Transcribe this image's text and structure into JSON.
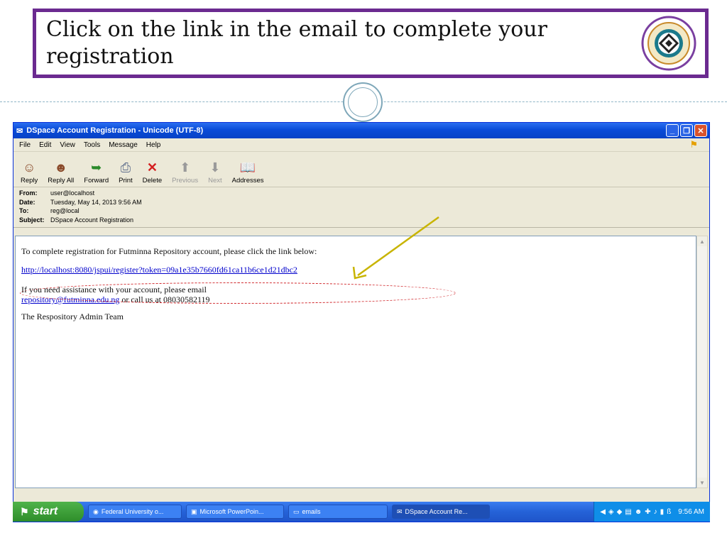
{
  "slide": {
    "title": "Click on the link in the email to complete your registration"
  },
  "window": {
    "title": "DSpace Account Registration - Unicode (UTF-8)",
    "menu": [
      "File",
      "Edit",
      "View",
      "Tools",
      "Message",
      "Help"
    ],
    "toolbar": [
      {
        "label": "Reply",
        "icon": "reply-icon",
        "enabled": true
      },
      {
        "label": "Reply All",
        "icon": "reply-all-icon",
        "enabled": true
      },
      {
        "label": "Forward",
        "icon": "forward-icon",
        "enabled": true
      },
      {
        "label": "Print",
        "icon": "printer-icon",
        "enabled": true
      },
      {
        "label": "Delete",
        "icon": "delete-icon",
        "enabled": true
      },
      {
        "label": "Previous",
        "icon": "previous-icon",
        "enabled": false
      },
      {
        "label": "Next",
        "icon": "next-icon",
        "enabled": false
      },
      {
        "label": "Addresses",
        "icon": "address-book-icon",
        "enabled": true
      }
    ],
    "headers": {
      "from_label": "From:",
      "from": "user@localhost",
      "date_label": "Date:",
      "date": "Tuesday, May 14, 2013 9:56 AM",
      "to_label": "To:",
      "to": "reg@local",
      "subject_label": "Subject:",
      "subject": "DSpace Account Registration"
    }
  },
  "email": {
    "line1": "To complete registration for Futminna Repository account, please click the link below:",
    "link": "http://localhost:8080/jspui/register?token=09a1e35b7660fd61ca11b6ce1d21dbc2",
    "assist_text": "If you need assistance with your account, please email",
    "assist_email": "repository@futminna.edu.ng",
    "assist_phone_text": " or call us at 08030582119",
    "signature": "The Respository Admin Team"
  },
  "taskbar": {
    "start_label": "start",
    "tasks": [
      {
        "label": "Federal University o...",
        "active": false
      },
      {
        "label": "Microsoft PowerPoin...",
        "active": false
      },
      {
        "label": "emails",
        "active": false
      },
      {
        "label": "DSpace Account Re...",
        "active": true
      }
    ],
    "clock": "9:56 AM"
  },
  "colors": {
    "title_border": "#6b2a90",
    "annotation_ellipse": "#d0262a",
    "annotation_arrow": "#c8b400",
    "xp_titlebar": "#0a4bd8"
  }
}
